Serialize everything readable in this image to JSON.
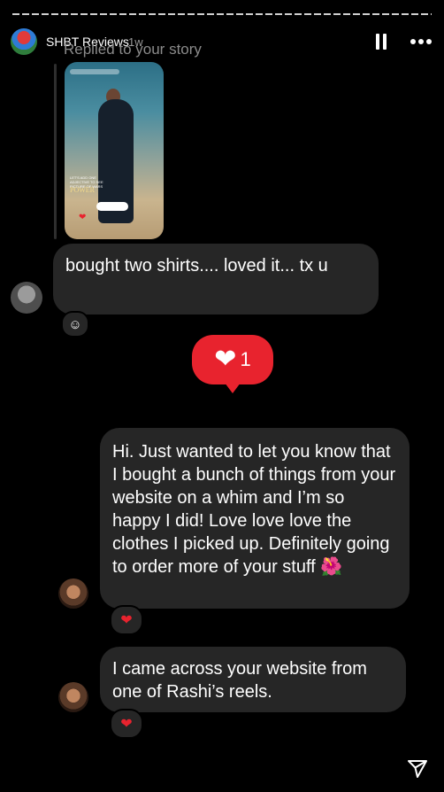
{
  "header": {
    "name": "SHBT Reviews",
    "time": "1w",
    "replied_label": "Replied to your story"
  },
  "story_thumb": {
    "caption": "LET'S ADD ONE ADJECTIVE TO SEE PICTURE OF WARS",
    "title": "POWER"
  },
  "messages": [
    {
      "text": "bought two shirts.... loved it... tx u"
    },
    {
      "text": "Hi. Just wanted to let you know that I bought a bunch of things from your website on a whim and I’m so happy I did! Love love love the clothes I picked up. Definitely going to order more of your stuff 🌺"
    },
    {
      "text": "I came across your website from one of Rashi’s reels."
    }
  ],
  "like_badge": {
    "count": "1"
  },
  "icons": {
    "pause": "pause-icon",
    "more": "more-icon",
    "add_reaction": "add-reaction-icon",
    "heart": "heart-icon",
    "share": "share-icon"
  },
  "colors": {
    "accent_red": "#e8232e",
    "bubble": "#262626"
  }
}
